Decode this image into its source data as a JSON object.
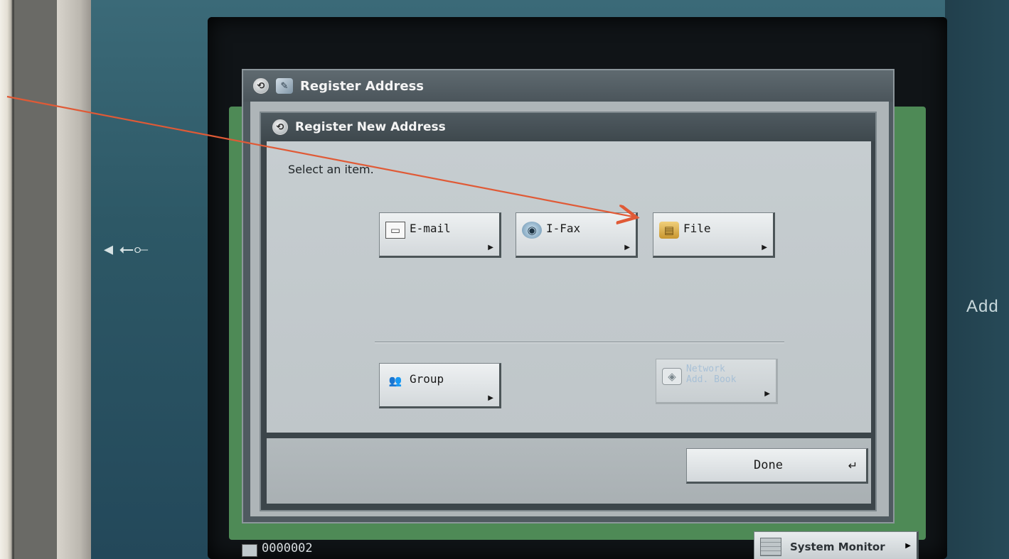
{
  "screen": {
    "side_label": "Add",
    "usb_symbol": "◂ ⭠⟜"
  },
  "outer_window": {
    "title": "Register Address"
  },
  "inner_window": {
    "title": "Register New Address",
    "prompt": "Select an item."
  },
  "buttons": {
    "email": {
      "label": "E-mail",
      "icon": "envelope-icon"
    },
    "ifax": {
      "label": "I-Fax",
      "icon": "ifax-icon"
    },
    "file": {
      "label": "File",
      "icon": "file-icon"
    },
    "group": {
      "label": "Group",
      "icon": "group-icon"
    },
    "network": {
      "label": "Network\nAdd. Book",
      "icon": "network-addressbook-icon",
      "enabled": false
    },
    "done": {
      "label": "Done"
    }
  },
  "status_bar": {
    "job_id": "0000002",
    "system_monitor": "System Monitor"
  },
  "annotation": {
    "color": "#e05a36",
    "target": "file-button"
  }
}
